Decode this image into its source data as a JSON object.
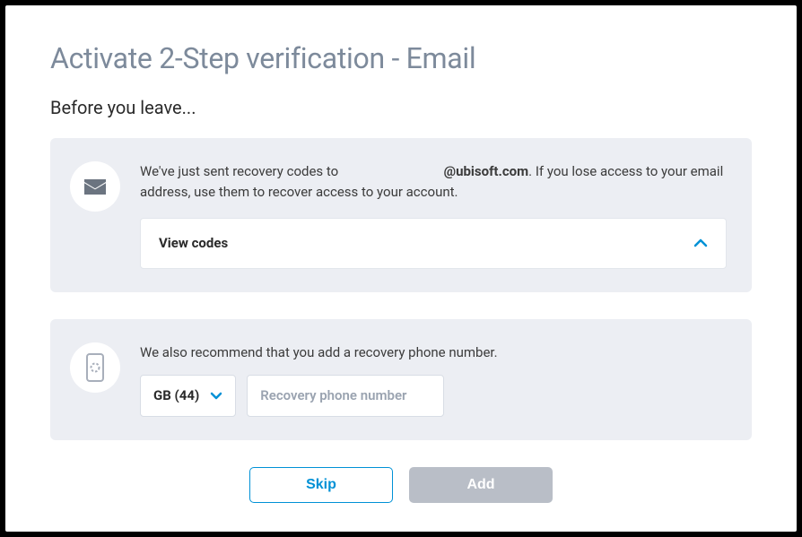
{
  "title": "Activate 2-Step verification - Email",
  "subtitle": "Before you leave...",
  "card1": {
    "text_prefix": "We've just sent recovery codes to ",
    "email_domain": "@ubisoft.com",
    "text_suffix": ". If you lose access to your email address, use them to recover access to your account.",
    "view_codes_label": "View codes"
  },
  "card2": {
    "text_prefix": "We also recommend that you ",
    "text_bold": "add a recovery phone number",
    "text_suffix": ".",
    "country_label": "GB (44)",
    "phone_placeholder": "Recovery phone number"
  },
  "actions": {
    "skip": "Skip",
    "add": "Add"
  }
}
